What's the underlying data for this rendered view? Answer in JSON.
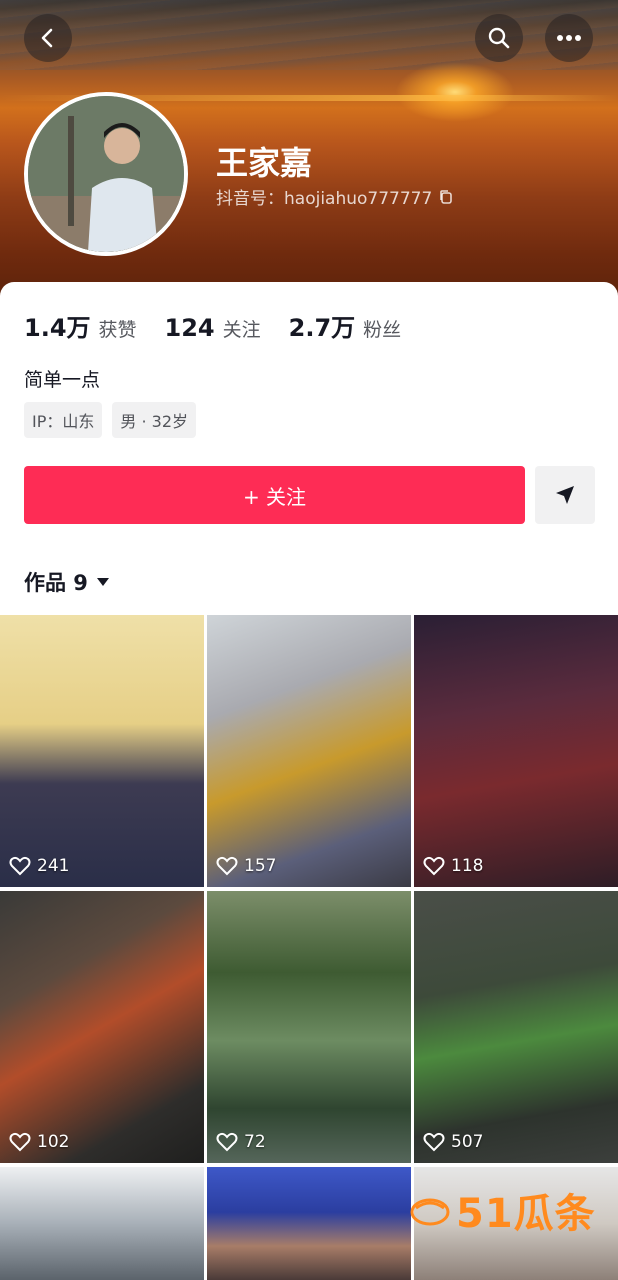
{
  "header": {
    "back_icon": "chevron-left-icon",
    "search_icon": "search-icon",
    "more_icon": "more-dots-icon"
  },
  "profile": {
    "name": "王家嘉",
    "douyin_id": "抖音号：haojiahuo777777",
    "copy_icon": "copy-icon"
  },
  "stats": [
    {
      "value": "1.4万",
      "label": "获赞"
    },
    {
      "value": "124",
      "label": "关注"
    },
    {
      "value": "2.7万",
      "label": "粉丝"
    }
  ],
  "bio": "简单一点",
  "tags": [
    "IP：山东",
    "男 · 32岁"
  ],
  "actions": {
    "follow_label": "+ 关注",
    "follow_color": "#fe2c55",
    "share_icon": "send-icon"
  },
  "works_tab": {
    "label": "作品 9",
    "icon": "caret-down-icon"
  },
  "grid": [
    {
      "likes": "241"
    },
    {
      "likes": "157"
    },
    {
      "likes": "118"
    },
    {
      "likes": "102"
    },
    {
      "likes": "72"
    },
    {
      "likes": "507"
    }
  ],
  "watermark": "51瓜条"
}
